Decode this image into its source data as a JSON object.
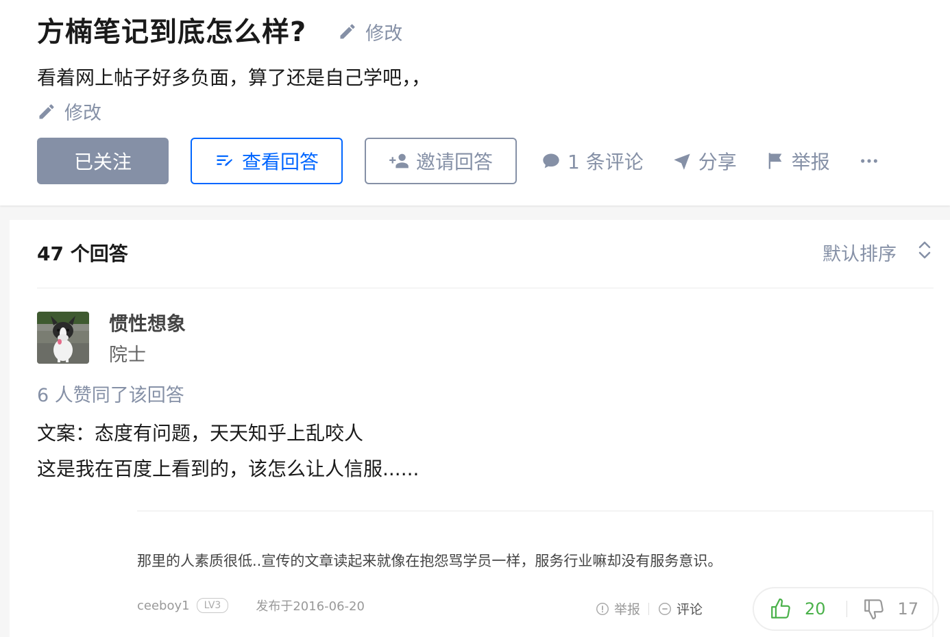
{
  "question": {
    "title": "方楠笔记到底怎么样?",
    "title_edit_label": "修改",
    "detail": "看着网上帖子好多负面，算了还是自己学吧，，",
    "detail_edit_label": "修改"
  },
  "actions": {
    "follow_label": "已关注",
    "view_answers_label": "查看回答",
    "invite_label": "邀请回答",
    "comments_label": "1 条评论",
    "share_label": "分享",
    "report_label": "举报",
    "more_icon": "more-dots-icon"
  },
  "answers": {
    "count_label": "47 个回答",
    "sort_label": "默认排序"
  },
  "answer": {
    "author_name": "惯性想象",
    "author_badge": "院士",
    "vote_summary": "6 人赞同了该回答",
    "lines": [
      "文案：态度有问题，天天知乎上乱咬人",
      "这是我在百度上看到的，该怎么让人信服......"
    ],
    "embed": {
      "text": "那里的人素质很低..宣传的文章读起来就像在抱怨骂学员一样，服务行业嘛却没有服务意识。",
      "username": "ceeboy1",
      "level": "LV3",
      "date": "发布于2016-06-20",
      "report_label": "举报",
      "comment_label": "评论",
      "upvotes": "20",
      "downvotes": "17"
    }
  },
  "colors": {
    "primary_blue": "#0066ff",
    "muted_gray": "#8590a6",
    "upvote_green": "#4ab14a"
  }
}
